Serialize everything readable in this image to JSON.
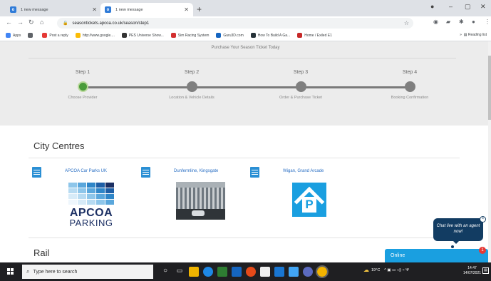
{
  "browser": {
    "tabs": [
      {
        "label": "1 new message",
        "active": false
      },
      {
        "label": "1 new message",
        "active": true
      }
    ],
    "url": "seasontickets.apcoa.co.uk/season/step1",
    "bookmarks": [
      {
        "label": "Apps",
        "color": "#4285f4"
      },
      {
        "label": "",
        "color": "#5f6368"
      },
      {
        "label": "Post a reply",
        "color": "#e53935"
      },
      {
        "label": "http://www.google....",
        "color": "#fbbc05"
      },
      {
        "label": "PES Universe Show...",
        "color": "#333333"
      },
      {
        "label": "Sim Racing System",
        "color": "#d32f2f"
      },
      {
        "label": "Guru3D.com",
        "color": "#1565c0"
      },
      {
        "label": "How To Build A Ga...",
        "color": "#263238"
      },
      {
        "label": "Home / Exiled E1",
        "color": "#c62828"
      }
    ],
    "reading_list": "Reading list"
  },
  "hero": {
    "title": "Purchase Your Season Ticket Today",
    "steps": [
      {
        "title": "Step 1",
        "desc": "Choose Provider",
        "active": true
      },
      {
        "title": "Step 2",
        "desc": "Location & Vehicle Details",
        "active": false
      },
      {
        "title": "Step 3",
        "desc": "Order & Purchase Ticket",
        "active": false
      },
      {
        "title": "Step 4",
        "desc": "Booking Confirmation",
        "active": false
      }
    ]
  },
  "sections": {
    "city_centres": "City Centres",
    "rail": "Rail"
  },
  "providers": [
    {
      "label": "APCOA Car Parks UK"
    },
    {
      "label": "Dunfermline, Kingsgate"
    },
    {
      "label": "Wigan, Grand Arcade"
    }
  ],
  "apcoa_logo": {
    "line1": "APCOA",
    "line2": "PARKING"
  },
  "wigan_logo": {
    "letter": "P"
  },
  "chat": {
    "bubble": "Chat live with an agent now!",
    "status": "Online",
    "badge": "1",
    "close": "×"
  },
  "taskbar": {
    "search_placeholder": "Type here to search",
    "weather": "19°C",
    "time": "14:47",
    "date": "14/07/2021"
  },
  "colors": {
    "accent": "#1a9fe0",
    "step_active": "#4a9c3a",
    "chat_dark": "#123c62"
  }
}
